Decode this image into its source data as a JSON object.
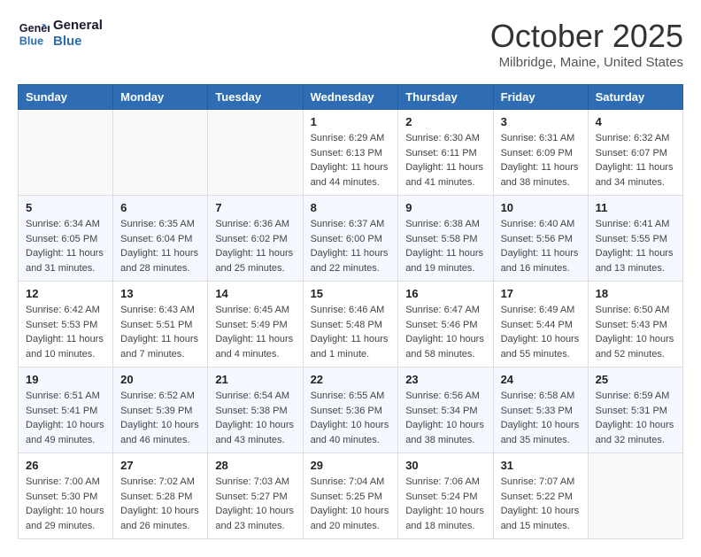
{
  "header": {
    "logo_line1": "General",
    "logo_line2": "Blue",
    "month_title": "October 2025",
    "location": "Milbridge, Maine, United States"
  },
  "weekdays": [
    "Sunday",
    "Monday",
    "Tuesday",
    "Wednesday",
    "Thursday",
    "Friday",
    "Saturday"
  ],
  "weeks": [
    [
      {
        "day": "",
        "sunrise": "",
        "sunset": "",
        "daylight": ""
      },
      {
        "day": "",
        "sunrise": "",
        "sunset": "",
        "daylight": ""
      },
      {
        "day": "",
        "sunrise": "",
        "sunset": "",
        "daylight": ""
      },
      {
        "day": "1",
        "sunrise": "Sunrise: 6:29 AM",
        "sunset": "Sunset: 6:13 PM",
        "daylight": "Daylight: 11 hours and 44 minutes."
      },
      {
        "day": "2",
        "sunrise": "Sunrise: 6:30 AM",
        "sunset": "Sunset: 6:11 PM",
        "daylight": "Daylight: 11 hours and 41 minutes."
      },
      {
        "day": "3",
        "sunrise": "Sunrise: 6:31 AM",
        "sunset": "Sunset: 6:09 PM",
        "daylight": "Daylight: 11 hours and 38 minutes."
      },
      {
        "day": "4",
        "sunrise": "Sunrise: 6:32 AM",
        "sunset": "Sunset: 6:07 PM",
        "daylight": "Daylight: 11 hours and 34 minutes."
      }
    ],
    [
      {
        "day": "5",
        "sunrise": "Sunrise: 6:34 AM",
        "sunset": "Sunset: 6:05 PM",
        "daylight": "Daylight: 11 hours and 31 minutes."
      },
      {
        "day": "6",
        "sunrise": "Sunrise: 6:35 AM",
        "sunset": "Sunset: 6:04 PM",
        "daylight": "Daylight: 11 hours and 28 minutes."
      },
      {
        "day": "7",
        "sunrise": "Sunrise: 6:36 AM",
        "sunset": "Sunset: 6:02 PM",
        "daylight": "Daylight: 11 hours and 25 minutes."
      },
      {
        "day": "8",
        "sunrise": "Sunrise: 6:37 AM",
        "sunset": "Sunset: 6:00 PM",
        "daylight": "Daylight: 11 hours and 22 minutes."
      },
      {
        "day": "9",
        "sunrise": "Sunrise: 6:38 AM",
        "sunset": "Sunset: 5:58 PM",
        "daylight": "Daylight: 11 hours and 19 minutes."
      },
      {
        "day": "10",
        "sunrise": "Sunrise: 6:40 AM",
        "sunset": "Sunset: 5:56 PM",
        "daylight": "Daylight: 11 hours and 16 minutes."
      },
      {
        "day": "11",
        "sunrise": "Sunrise: 6:41 AM",
        "sunset": "Sunset: 5:55 PM",
        "daylight": "Daylight: 11 hours and 13 minutes."
      }
    ],
    [
      {
        "day": "12",
        "sunrise": "Sunrise: 6:42 AM",
        "sunset": "Sunset: 5:53 PM",
        "daylight": "Daylight: 11 hours and 10 minutes."
      },
      {
        "day": "13",
        "sunrise": "Sunrise: 6:43 AM",
        "sunset": "Sunset: 5:51 PM",
        "daylight": "Daylight: 11 hours and 7 minutes."
      },
      {
        "day": "14",
        "sunrise": "Sunrise: 6:45 AM",
        "sunset": "Sunset: 5:49 PM",
        "daylight": "Daylight: 11 hours and 4 minutes."
      },
      {
        "day": "15",
        "sunrise": "Sunrise: 6:46 AM",
        "sunset": "Sunset: 5:48 PM",
        "daylight": "Daylight: 11 hours and 1 minute."
      },
      {
        "day": "16",
        "sunrise": "Sunrise: 6:47 AM",
        "sunset": "Sunset: 5:46 PM",
        "daylight": "Daylight: 10 hours and 58 minutes."
      },
      {
        "day": "17",
        "sunrise": "Sunrise: 6:49 AM",
        "sunset": "Sunset: 5:44 PM",
        "daylight": "Daylight: 10 hours and 55 minutes."
      },
      {
        "day": "18",
        "sunrise": "Sunrise: 6:50 AM",
        "sunset": "Sunset: 5:43 PM",
        "daylight": "Daylight: 10 hours and 52 minutes."
      }
    ],
    [
      {
        "day": "19",
        "sunrise": "Sunrise: 6:51 AM",
        "sunset": "Sunset: 5:41 PM",
        "daylight": "Daylight: 10 hours and 49 minutes."
      },
      {
        "day": "20",
        "sunrise": "Sunrise: 6:52 AM",
        "sunset": "Sunset: 5:39 PM",
        "daylight": "Daylight: 10 hours and 46 minutes."
      },
      {
        "day": "21",
        "sunrise": "Sunrise: 6:54 AM",
        "sunset": "Sunset: 5:38 PM",
        "daylight": "Daylight: 10 hours and 43 minutes."
      },
      {
        "day": "22",
        "sunrise": "Sunrise: 6:55 AM",
        "sunset": "Sunset: 5:36 PM",
        "daylight": "Daylight: 10 hours and 40 minutes."
      },
      {
        "day": "23",
        "sunrise": "Sunrise: 6:56 AM",
        "sunset": "Sunset: 5:34 PM",
        "daylight": "Daylight: 10 hours and 38 minutes."
      },
      {
        "day": "24",
        "sunrise": "Sunrise: 6:58 AM",
        "sunset": "Sunset: 5:33 PM",
        "daylight": "Daylight: 10 hours and 35 minutes."
      },
      {
        "day": "25",
        "sunrise": "Sunrise: 6:59 AM",
        "sunset": "Sunset: 5:31 PM",
        "daylight": "Daylight: 10 hours and 32 minutes."
      }
    ],
    [
      {
        "day": "26",
        "sunrise": "Sunrise: 7:00 AM",
        "sunset": "Sunset: 5:30 PM",
        "daylight": "Daylight: 10 hours and 29 minutes."
      },
      {
        "day": "27",
        "sunrise": "Sunrise: 7:02 AM",
        "sunset": "Sunset: 5:28 PM",
        "daylight": "Daylight: 10 hours and 26 minutes."
      },
      {
        "day": "28",
        "sunrise": "Sunrise: 7:03 AM",
        "sunset": "Sunset: 5:27 PM",
        "daylight": "Daylight: 10 hours and 23 minutes."
      },
      {
        "day": "29",
        "sunrise": "Sunrise: 7:04 AM",
        "sunset": "Sunset: 5:25 PM",
        "daylight": "Daylight: 10 hours and 20 minutes."
      },
      {
        "day": "30",
        "sunrise": "Sunrise: 7:06 AM",
        "sunset": "Sunset: 5:24 PM",
        "daylight": "Daylight: 10 hours and 18 minutes."
      },
      {
        "day": "31",
        "sunrise": "Sunrise: 7:07 AM",
        "sunset": "Sunset: 5:22 PM",
        "daylight": "Daylight: 10 hours and 15 minutes."
      },
      {
        "day": "",
        "sunrise": "",
        "sunset": "",
        "daylight": ""
      }
    ]
  ]
}
